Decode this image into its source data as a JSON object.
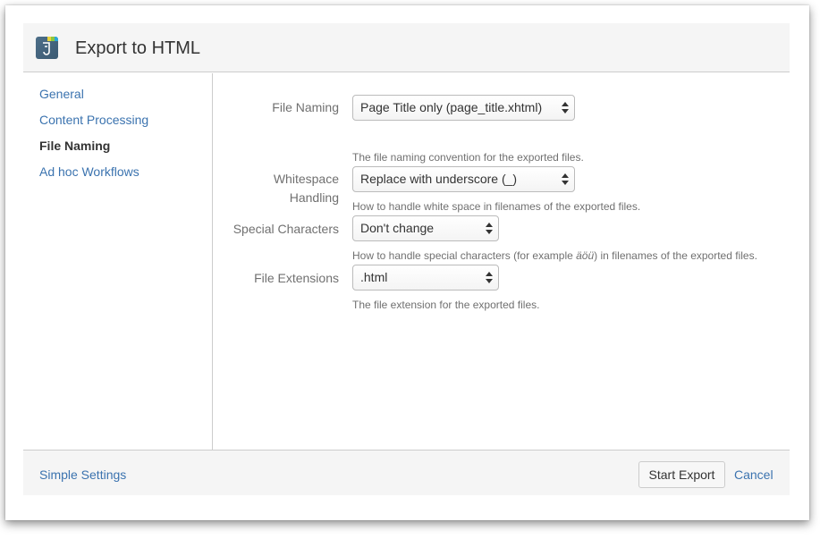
{
  "dialog": {
    "title": "Export to HTML",
    "icon": "export-app-icon"
  },
  "sidebar": {
    "items": [
      {
        "label": "General",
        "active": false
      },
      {
        "label": "Content Processing",
        "active": false
      },
      {
        "label": "File Naming",
        "active": true
      },
      {
        "label": "Ad hoc Workflows",
        "active": false
      }
    ]
  },
  "form": {
    "file_naming": {
      "label": "File Naming",
      "value": "Page Title only (page_title.xhtml)",
      "description": "The file naming convention for the exported files."
    },
    "whitespace": {
      "label_line1": "Whitespace",
      "label_line2": "Handling",
      "value": "Replace with underscore (_)",
      "description": "How to handle white space in filenames of the exported files."
    },
    "special_chars": {
      "label": "Special Characters",
      "value": "Don't change",
      "description_before": "How to handle special characters (for example ",
      "description_example": "äöü",
      "description_after": ") in filenames of the exported files."
    },
    "extensions": {
      "label": "File Extensions",
      "value": ".html",
      "description": "The file extension for the exported files."
    }
  },
  "footer": {
    "simple_settings": "Simple Settings",
    "start_export": "Start Export",
    "cancel": "Cancel"
  },
  "colors": {
    "link": "#3b73af",
    "header_bg": "#f5f5f5",
    "border": "#cccccc"
  }
}
